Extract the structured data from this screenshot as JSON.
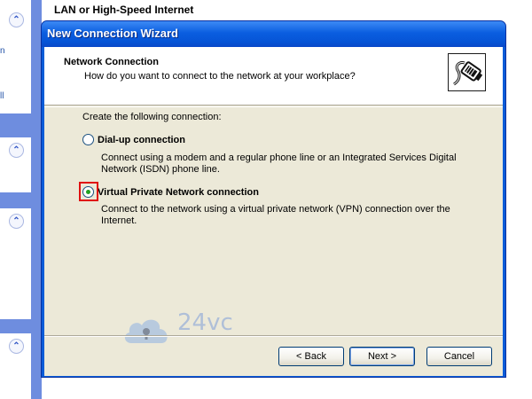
{
  "background_window": {
    "title": "LAN or High-Speed Internet",
    "taskpane_fragments": [
      "n",
      "ll"
    ]
  },
  "wizard": {
    "title": "New Connection Wizard",
    "header": {
      "title": "Network Connection",
      "subtitle": "How do you want to connect to the network at your workplace?",
      "icon": "network-cable-icon"
    },
    "prompt": "Create the following connection:",
    "options": [
      {
        "label": "Dial-up connection",
        "description": "Connect using a modem and a regular phone line or an Integrated Services Digital Network (ISDN) phone line.",
        "selected": false
      },
      {
        "label": "Virtual Private Network connection",
        "description": "Connect to the network using a virtual private network (VPN) connection over the Internet.",
        "selected": true
      }
    ],
    "buttons": {
      "back": "< Back",
      "next": "Next >",
      "cancel": "Cancel"
    }
  },
  "watermark": {
    "text": "24vc"
  },
  "colors": {
    "titlebar": "#0a5ee0",
    "dialog_face": "#ece9d8",
    "highlight": "#e01010",
    "radio_dot": "#21a121"
  }
}
